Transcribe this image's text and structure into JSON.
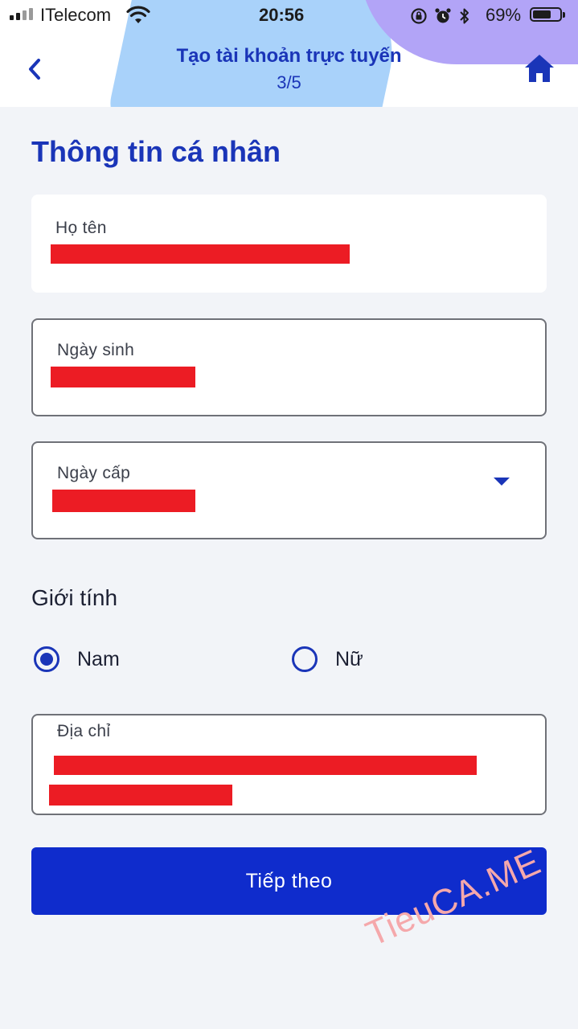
{
  "status_bar": {
    "carrier": "ITelecom",
    "time": "20:56",
    "battery_percent": "69%"
  },
  "nav": {
    "title": "Tạo tài khoản trực tuyến",
    "step": "3/5",
    "back_icon": "chevron-left-icon",
    "home_icon": "home-icon"
  },
  "form": {
    "section_title": "Thông tin cá nhân",
    "full_name": {
      "label": "Họ tên"
    },
    "birth_date": {
      "label": "Ngày sinh"
    },
    "issue_date": {
      "label": "Ngày cấp"
    },
    "gender": {
      "label": "Giới tính",
      "options": [
        {
          "label": "Nam",
          "selected": true
        },
        {
          "label": "Nữ",
          "selected": false
        }
      ]
    },
    "address": {
      "label": "Địa chỉ"
    },
    "next_button": "Tiếp theo"
  },
  "watermark": "TieuCA.ME",
  "colors": {
    "primary": "#1a35b8",
    "button": "#0f2ccc",
    "redaction": "#ec1c24",
    "header_blue_blob": "#a9d2fa",
    "header_purple_blob": "#b2a4f7"
  }
}
